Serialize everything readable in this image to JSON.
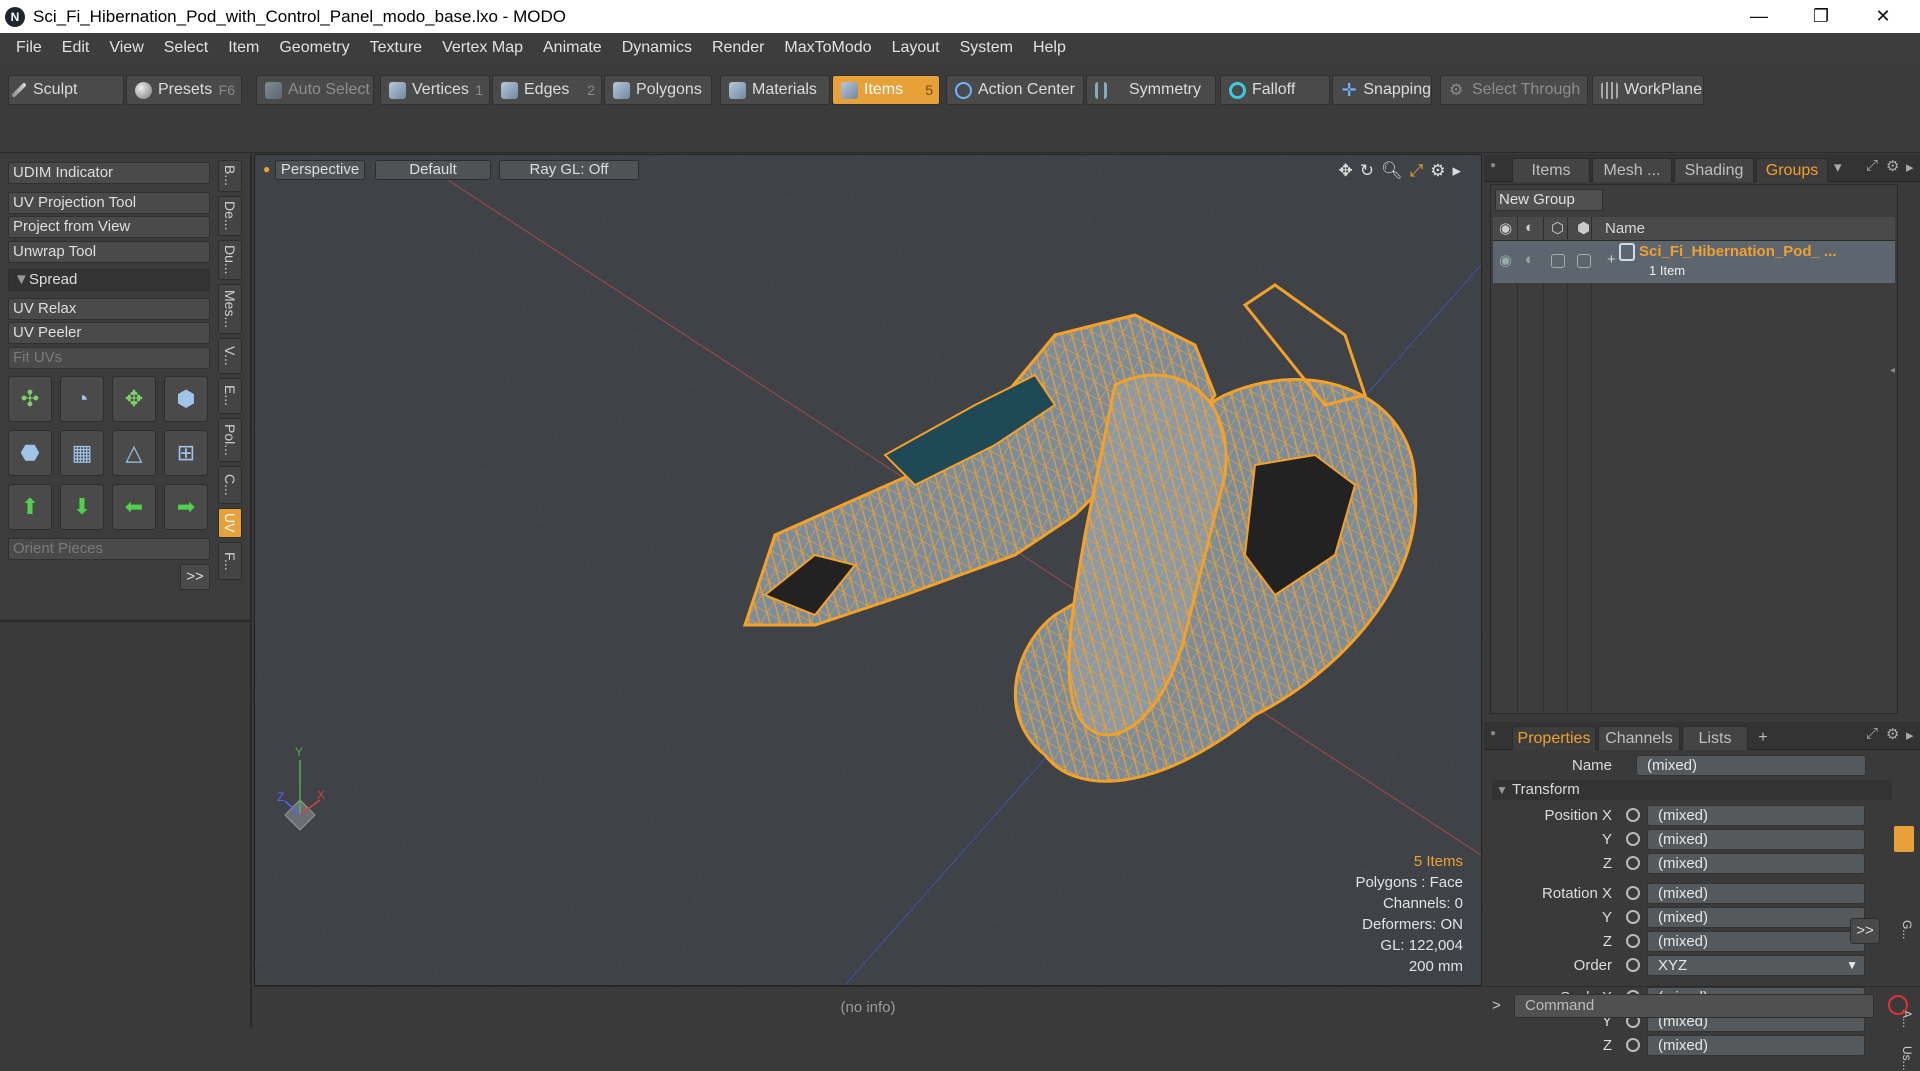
{
  "window": {
    "title": "Sci_Fi_Hibernation_Pod_with_Control_Panel_modo_base.lxo - MODO",
    "app_icon": "N",
    "minimize": "—",
    "restore": "❐",
    "close": "✕"
  },
  "menu": [
    "File",
    "Edit",
    "View",
    "Select",
    "Item",
    "Geometry",
    "Texture",
    "Vertex Map",
    "Animate",
    "Dynamics",
    "Render",
    "MaxToModo",
    "Layout",
    "System",
    "Help"
  ],
  "toolbar": {
    "sculpt": "Sculpt",
    "presets": "Presets",
    "presets_key": "F6",
    "auto_select": "Auto Select",
    "vertices": "Vertices",
    "vertices_count": "1",
    "edges": "Edges",
    "edges_count": "2",
    "polygons": "Polygons",
    "materials": "Materials",
    "items": "Items",
    "items_count": "5",
    "action_center": "Action Center",
    "symmetry": "Symmetry",
    "falloff": "Falloff",
    "snapping": "Snapping",
    "select_through": "Select Through",
    "workplane": "WorkPlane"
  },
  "left_panel": {
    "udim": "UDIM Indicator",
    "uv_projection": "UV Projection Tool",
    "project_from_view": "Project from View",
    "unwrap": "Unwrap Tool",
    "spread": "Spread",
    "uv_relax": "UV Relax",
    "uv_peeler": "UV Peeler",
    "fit_uvs": "Fit UVs",
    "orient_pieces": "Orient Pieces",
    "more": ">>",
    "vtabs": [
      "B...",
      "De...",
      "Du...",
      "Mes...",
      "V...",
      "E...",
      "Pol...",
      "C...",
      "UV",
      "F..."
    ]
  },
  "viewport": {
    "projection": "Perspective",
    "shading": "Default",
    "raygl": "Ray GL: Off",
    "info": {
      "items": "5 Items",
      "polygons": "Polygons : Face",
      "channels": "Channels: 0",
      "deformers": "Deformers: ON",
      "gl": "GL: 122,004",
      "scale": "200 mm"
    },
    "axis": {
      "y": "Y",
      "x": "X",
      "z": "Z"
    }
  },
  "status": "(no info)",
  "right_panel": {
    "tabs": [
      "Items",
      "Mesh ...",
      "Shading",
      "Groups"
    ],
    "new_group": "New Group",
    "col_name": "Name",
    "group_name": "Sci_Fi_Hibernation_Pod_ ...",
    "group_sub": "1 Item",
    "prop_tabs": [
      "Properties",
      "Channels",
      "Lists",
      "+"
    ],
    "name_label": "Name",
    "name_value": "(mixed)",
    "transform": "Transform",
    "position_x": "Position X",
    "rotation_x": "Rotation X",
    "scale_x": "Scale X",
    "y": "Y",
    "z": "Z",
    "mixed": "(mixed)",
    "order_label": "Order",
    "order_value": "XYZ",
    "more": ">>",
    "command": "Command",
    "side_tabs": [
      "G...",
      "A...",
      "Us..."
    ]
  }
}
